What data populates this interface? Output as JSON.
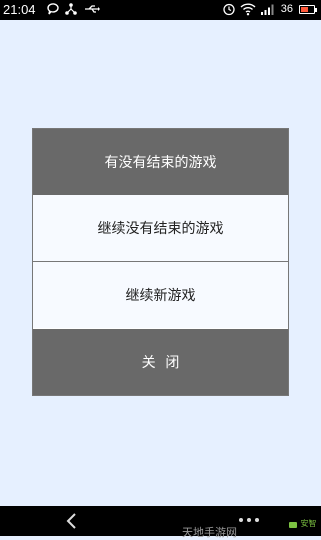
{
  "status_bar": {
    "time": "21:04",
    "battery_level": "36",
    "battery_color": "#ff5a3c",
    "icons": [
      "chat-bubble-icon",
      "share-icon",
      "usb-icon",
      "alarm-icon",
      "wifi-icon",
      "signal-icon",
      "battery-icon"
    ]
  },
  "dialog": {
    "title": "有没有结束的游戏",
    "option_continue": "继续没有结束的游戏",
    "option_new": "继续新游戏",
    "close_label": "关闭",
    "header_color": "#696969"
  },
  "nav_bar": {
    "icons": [
      "back-icon",
      "menu-dots-icon"
    ]
  },
  "watermark": {
    "text": "天地手游网",
    "logo_text": "安智"
  }
}
